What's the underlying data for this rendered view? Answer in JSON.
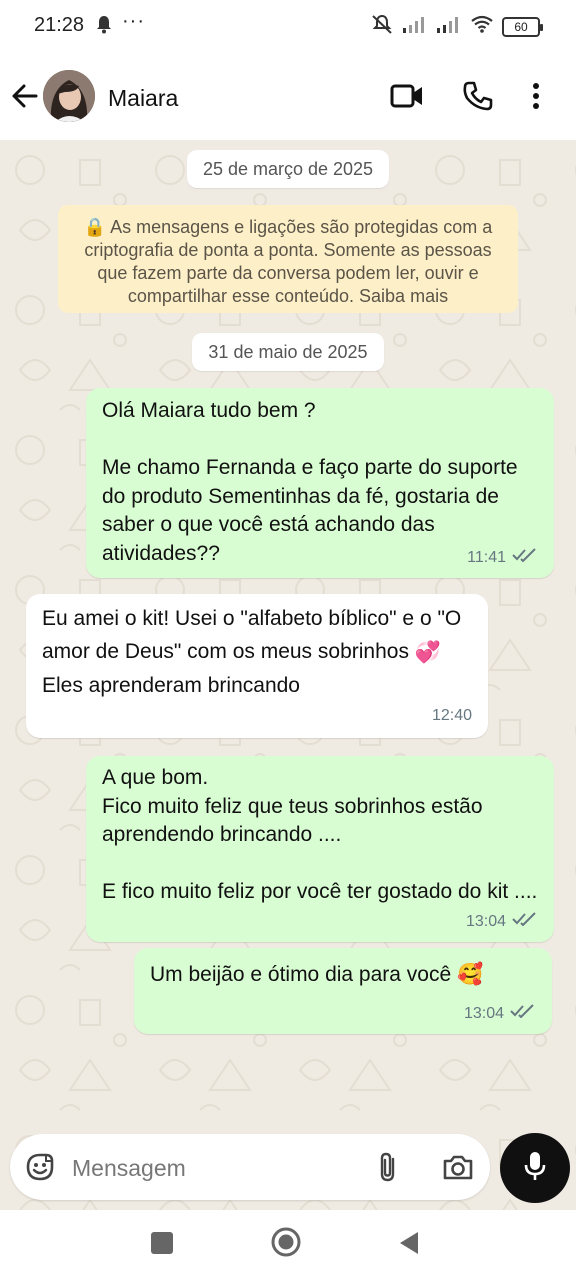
{
  "status_bar": {
    "time": "21:28",
    "battery": "60"
  },
  "header": {
    "contact_name": "Maiara"
  },
  "chat": {
    "date_1": "25 de março de 2025",
    "encryption_notice": "🔒 As mensagens e ligações são protegidas com a criptografia de ponta a ponta. Somente as pessoas que fazem parte da conversa podem ler, ouvir e compartilhar esse conteúdo. Saiba mais",
    "date_2": "31 de maio de 2025",
    "messages": [
      {
        "direction": "outgoing",
        "text": "Olá Maiara tudo bem ?\n\nMe chamo Fernanda e faço parte do suporte do produto Sementinhas da fé, gostaria de saber o que você está achando das atividades??",
        "time": "11:41",
        "status": "read"
      },
      {
        "direction": "incoming",
        "text_part1": "Eu amei o kit! Usei o \"alfabeto bíblico\" e o \"O amor de Deus\" com os meus sobrinhos",
        "emoji": "💞",
        "text_part2": "Eles aprenderam brincando",
        "time": "12:40"
      },
      {
        "direction": "outgoing",
        "text": "A que bom.\nFico muito feliz que teus sobrinhos estão aprendendo brincando ....\n\nE fico muito feliz por você ter gostado do kit  ....",
        "time": "13:04",
        "status": "read"
      },
      {
        "direction": "outgoing",
        "text": "Um beijão e ótimo dia para você",
        "emoji": "🥰",
        "time": "13:04",
        "status": "read"
      }
    ]
  },
  "composer": {
    "placeholder": "Mensagem"
  },
  "colors": {
    "outgoing_bubble": "#d9fdd3",
    "incoming_bubble": "#ffffff",
    "chat_background": "#efeae2",
    "notice_background": "#fdf0c8"
  }
}
